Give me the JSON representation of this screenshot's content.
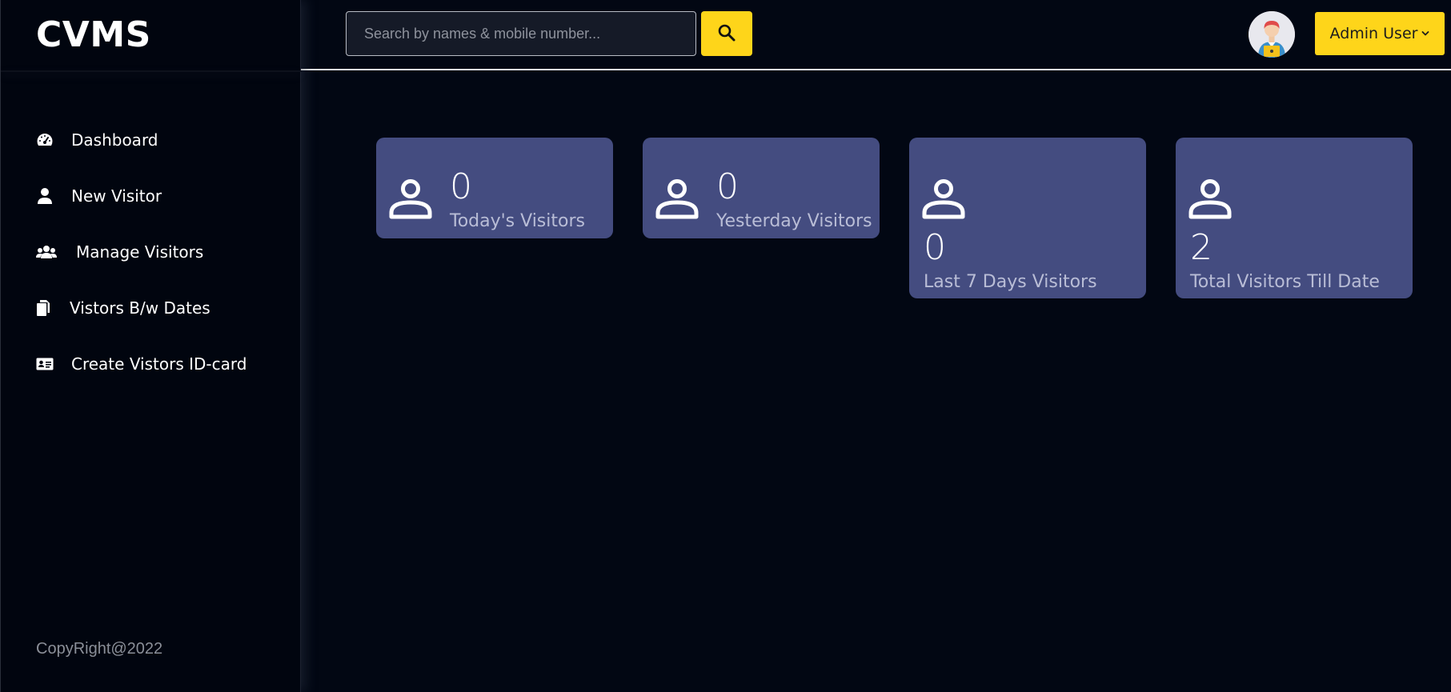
{
  "brand": {
    "title": "CVMS"
  },
  "search": {
    "placeholder": "Search by names & mobile number...",
    "value": "",
    "button_icon": "search-icon"
  },
  "header": {
    "avatar_icon": "user-avatar-icon",
    "user_menu_label": "Admin User",
    "user_menu_icon": "chevron-down-icon"
  },
  "sidebar": {
    "items": [
      {
        "label": "Dashboard",
        "icon": "dashboard-gauge-icon"
      },
      {
        "label": "New Visitor",
        "icon": "user-icon"
      },
      {
        "label": "Manage Visitors",
        "icon": "users-group-icon"
      },
      {
        "label": "Vistors B/w Dates",
        "icon": "documents-icon"
      },
      {
        "label": "Create Vistors ID-card",
        "icon": "id-card-icon"
      }
    ],
    "copyright": "CopyRight@2022"
  },
  "stats": [
    {
      "value": "0",
      "label": "Today's Visitors",
      "icon": "person-icon"
    },
    {
      "value": "0",
      "label": "Yesterday Visitors",
      "icon": "person-icon"
    },
    {
      "value": "0",
      "label": "Last 7 Days Visitors",
      "icon": "person-icon"
    },
    {
      "value": "2",
      "label": "Total Visitors Till Date",
      "icon": "person-icon"
    }
  ],
  "colors": {
    "background": "#020713",
    "accent": "#fed51a",
    "card": "#444c80",
    "card_label": "#b9bdd6",
    "copyright": "#8b8f98"
  }
}
